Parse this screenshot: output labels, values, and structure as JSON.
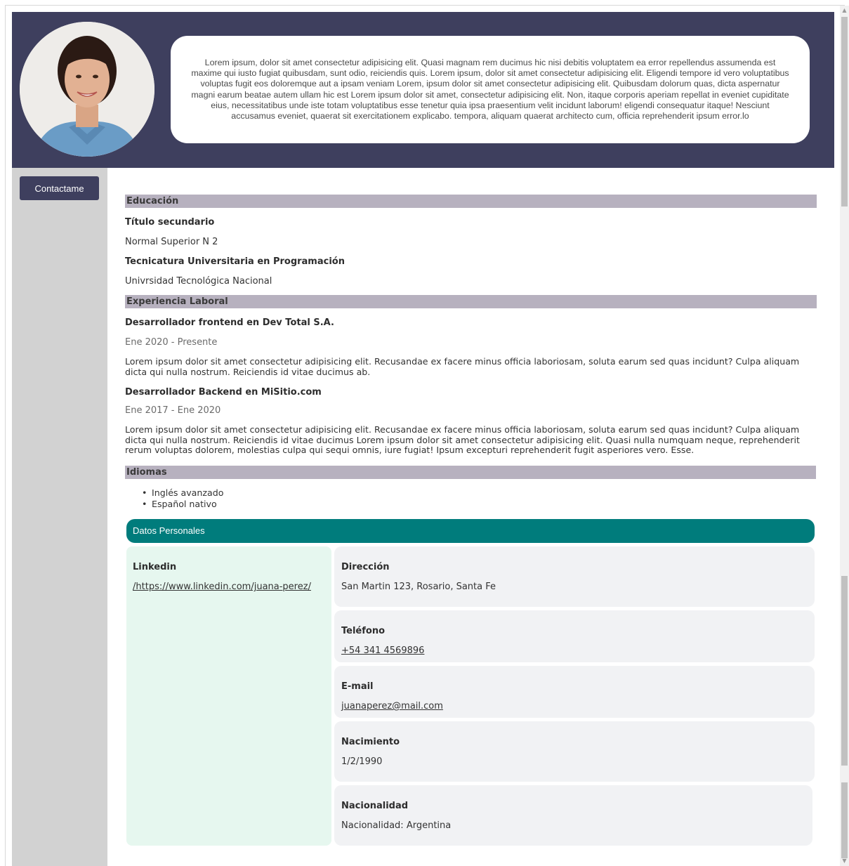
{
  "header": {
    "intro_text": "Lorem ipsum, dolor sit amet consectetur adipisicing elit. Quasi magnam rem ducimus hic nisi debitis voluptatem ea error repellendus assumenda est maxime qui iusto fugiat quibusdam, sunt odio, reiciendis quis. Lorem ipsum, dolor sit amet consectetur adipisicing elit. Eligendi tempore id vero voluptatibus voluptas fugit eos doloremque aut a ipsam veniam Lorem, ipsum dolor sit amet consectetur adipisicing elit. Quibusdam dolorum quas, dicta aspernatur magni earum beatae autem ullam hic est Lorem ipsum dolor sit amet, consectetur adipisicing elit. Non, itaque corporis aperiam repellat in eveniet cupiditate eius, necessitatibus unde iste totam voluptatibus esse tenetur quia ipsa praesentium velit incidunt laborum! eligendi consequatur itaque! Nesciunt accusamus eveniet, quaerat sit exercitationem explicabo. tempora, aliquam quaerat architecto cum, officia reprehenderit ipsum error.lo"
  },
  "sidebar": {
    "contact_label": "Contactame"
  },
  "education": {
    "heading": "Educación",
    "items": [
      {
        "title": "Título secundario",
        "place": "Normal Superior N 2"
      },
      {
        "title": "Tecnicatura Universitaria en Programación",
        "place": "Univrsidad Tecnológica Nacional"
      }
    ]
  },
  "experience": {
    "heading": "Experiencia Laboral",
    "items": [
      {
        "title": "Desarrollador frontend en Dev Total S.A.",
        "period": "Ene 2020 - Presente",
        "description": "Lorem ipsum dolor sit amet consectetur adipisicing elit. Recusandae ex facere minus officia laboriosam, soluta earum sed quas incidunt? Culpa aliquam dicta qui nulla nostrum. Reiciendis id vitae ducimus ab."
      },
      {
        "title": "Desarrollador Backend en MiSitio.com",
        "period": "Ene 2017 - Ene 2020",
        "description": "Lorem ipsum dolor sit amet consectetur adipisicing elit. Recusandae ex facere minus officia laboriosam, soluta earum sed quas incidunt? Culpa aliquam dicta qui nulla nostrum. Reiciendis id vitae ducimus Lorem ipsum dolor sit amet consectetur adipisicing elit. Quasi nulla numquam neque, reprehenderit rerum voluptas dolorem, molestias culpa qui sequi omnis, iure fugiat! Ipsum excepturi reprehenderit fugit asperiores vero. Esse."
      }
    ]
  },
  "languages": {
    "heading": "Idiomas",
    "items": [
      "Inglés avanzado",
      "Español nativo"
    ]
  },
  "personal": {
    "heading": "Datos Personales",
    "linkedin": {
      "label": "Linkedin",
      "value": "/https://www.linkedin.com/juana-perez/"
    },
    "address": {
      "label": "Dirección",
      "value": "San Martin 123, Rosario, Santa Fe"
    },
    "phone": {
      "label": "Teléfono",
      "value": "+54 341 4569896"
    },
    "email": {
      "label": "E-mail",
      "value": "juanaperez@mail.com"
    },
    "birth": {
      "label": "Nacimiento",
      "value": "1/2/1990"
    },
    "nationality": {
      "label": "Nacionalidad",
      "value": "Nacionalidad: Argentina"
    }
  },
  "colors": {
    "header_bg": "#3e3f5e",
    "section_head_bg": "#b7b1bf",
    "personal_bar_bg": "#007c7c",
    "linkedin_card_bg": "#e6f7ef",
    "card_bg": "#f1f2f4",
    "sidebar_bg": "#d2d2d2"
  }
}
